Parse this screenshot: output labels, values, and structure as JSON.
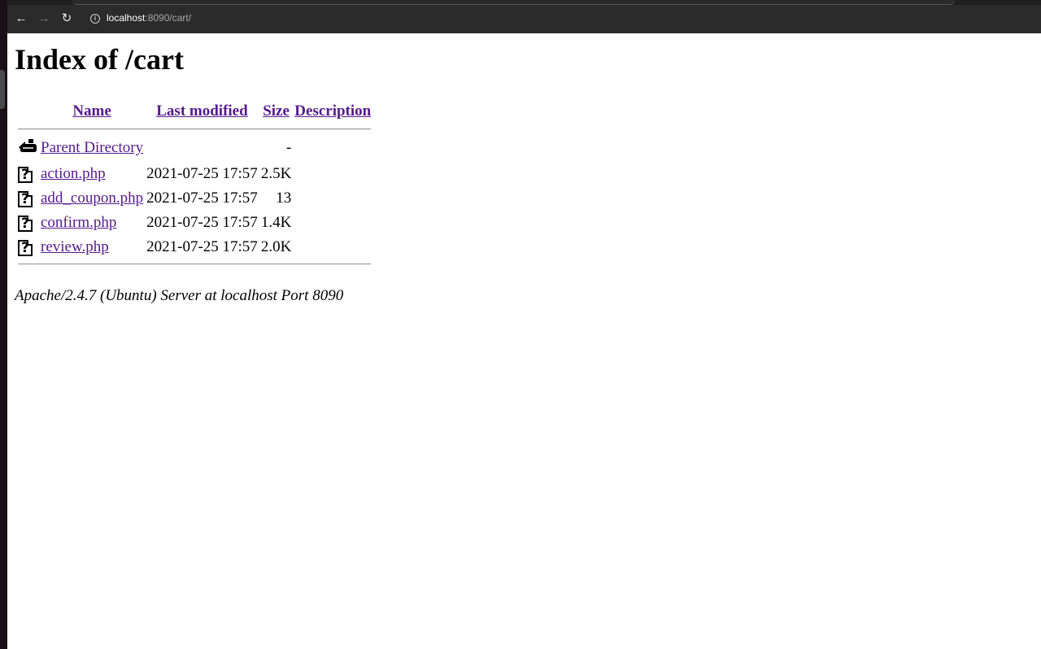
{
  "browser": {
    "back_icon": "arrow-left-icon",
    "forward_icon": "arrow-right-icon",
    "reload_icon": "reload-icon",
    "site_info_icon": "info-icon",
    "url_host": "localhost",
    "url_rest": ":8090/cart/"
  },
  "page": {
    "title": "Index of /cart",
    "columns": {
      "name": "Name",
      "last_modified": "Last modified",
      "size": "Size",
      "description": "Description"
    },
    "entries": [
      {
        "icon": "parent-directory-icon",
        "name": "Parent Directory",
        "last_modified": "",
        "size": "-"
      },
      {
        "icon": "unknown-file-icon",
        "name": "action.php",
        "last_modified": "2021-07-25 17:57",
        "size": "2.5K"
      },
      {
        "icon": "unknown-file-icon",
        "name": "add_coupon.php",
        "last_modified": "2021-07-25 17:57",
        "size": "13"
      },
      {
        "icon": "unknown-file-icon",
        "name": "confirm.php",
        "last_modified": "2021-07-25 17:57",
        "size": "1.4K"
      },
      {
        "icon": "unknown-file-icon",
        "name": "review.php",
        "last_modified": "2021-07-25 17:57",
        "size": "2.0K"
      }
    ],
    "footer": "Apache/2.4.7 (Ubuntu) Server at localhost Port 8090"
  }
}
